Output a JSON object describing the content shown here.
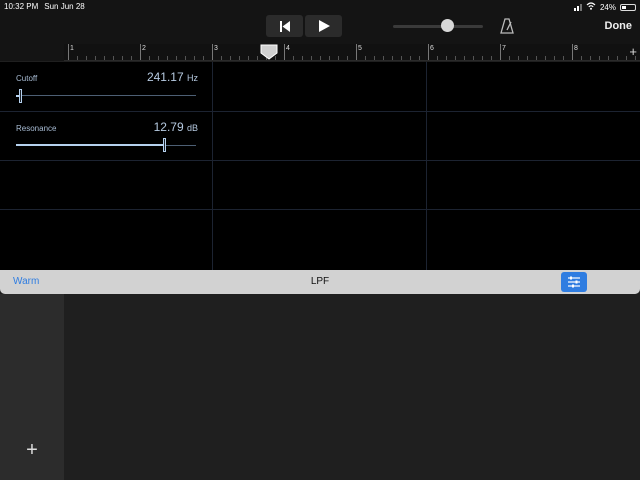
{
  "status": {
    "time": "10:32 PM",
    "date": "Sun Jun 28",
    "battery": "24%"
  },
  "toolbar": {
    "done_label": "Done",
    "volume_level": 0.6,
    "icons": [
      "rewind-icon",
      "play-icon",
      "metronome-icon"
    ]
  },
  "ruler": {
    "bars": [
      "1",
      "2",
      "3",
      "4",
      "5",
      "6",
      "7",
      "8"
    ],
    "add_icon": "+"
  },
  "params": {
    "cutoff": {
      "label": "Cutoff",
      "value": "241.17",
      "unit": "Hz",
      "slider_fraction": 0.02
    },
    "resonance": {
      "label": "Resonance",
      "value": "12.79",
      "unit": "dB",
      "slider_fraction": 0.82
    }
  },
  "plugin": {
    "preset": "Warm",
    "title": "LPF"
  },
  "track_list": {
    "add_label": "+"
  },
  "colors": {
    "accent": "#2f7de1",
    "slider": "#b5d1ee",
    "background": "#000000"
  }
}
